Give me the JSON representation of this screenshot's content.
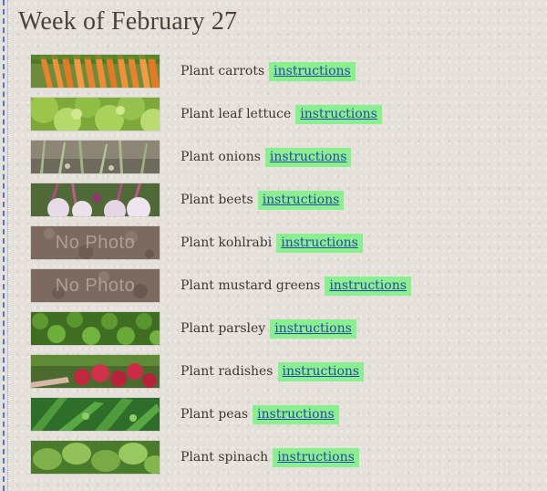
{
  "page": {
    "title": "Week of February 27"
  },
  "plants": [
    {
      "task": "Plant carrots",
      "link": "instructions",
      "photo": "carrots-photo"
    },
    {
      "task": "Plant leaf lettuce",
      "link": "instructions",
      "photo": "lettuce-photo"
    },
    {
      "task": "Plant onions",
      "link": "instructions",
      "photo": "onions-photo"
    },
    {
      "task": "Plant beets",
      "link": "instructions",
      "photo": "beets-photo"
    },
    {
      "task": "Plant kohlrabi",
      "link": "instructions",
      "photo": "no-photo-placeholder",
      "placeholder_text": "No Photo"
    },
    {
      "task": "Plant mustard greens",
      "link": "instructions",
      "photo": "no-photo-placeholder",
      "placeholder_text": "No Photo"
    },
    {
      "task": "Plant parsley",
      "link": "instructions",
      "photo": "parsley-photo"
    },
    {
      "task": "Plant radishes",
      "link": "instructions",
      "photo": "radishes-photo"
    },
    {
      "task": "Plant peas",
      "link": "instructions",
      "photo": "peas-photo"
    },
    {
      "task": "Plant spinach",
      "link": "instructions",
      "photo": "spinach-photo"
    }
  ],
  "colors": {
    "background": "#e5e1da",
    "link_highlight": "#8aef8e",
    "link_text": "#2a48a8",
    "title_text": "#4a4139"
  }
}
